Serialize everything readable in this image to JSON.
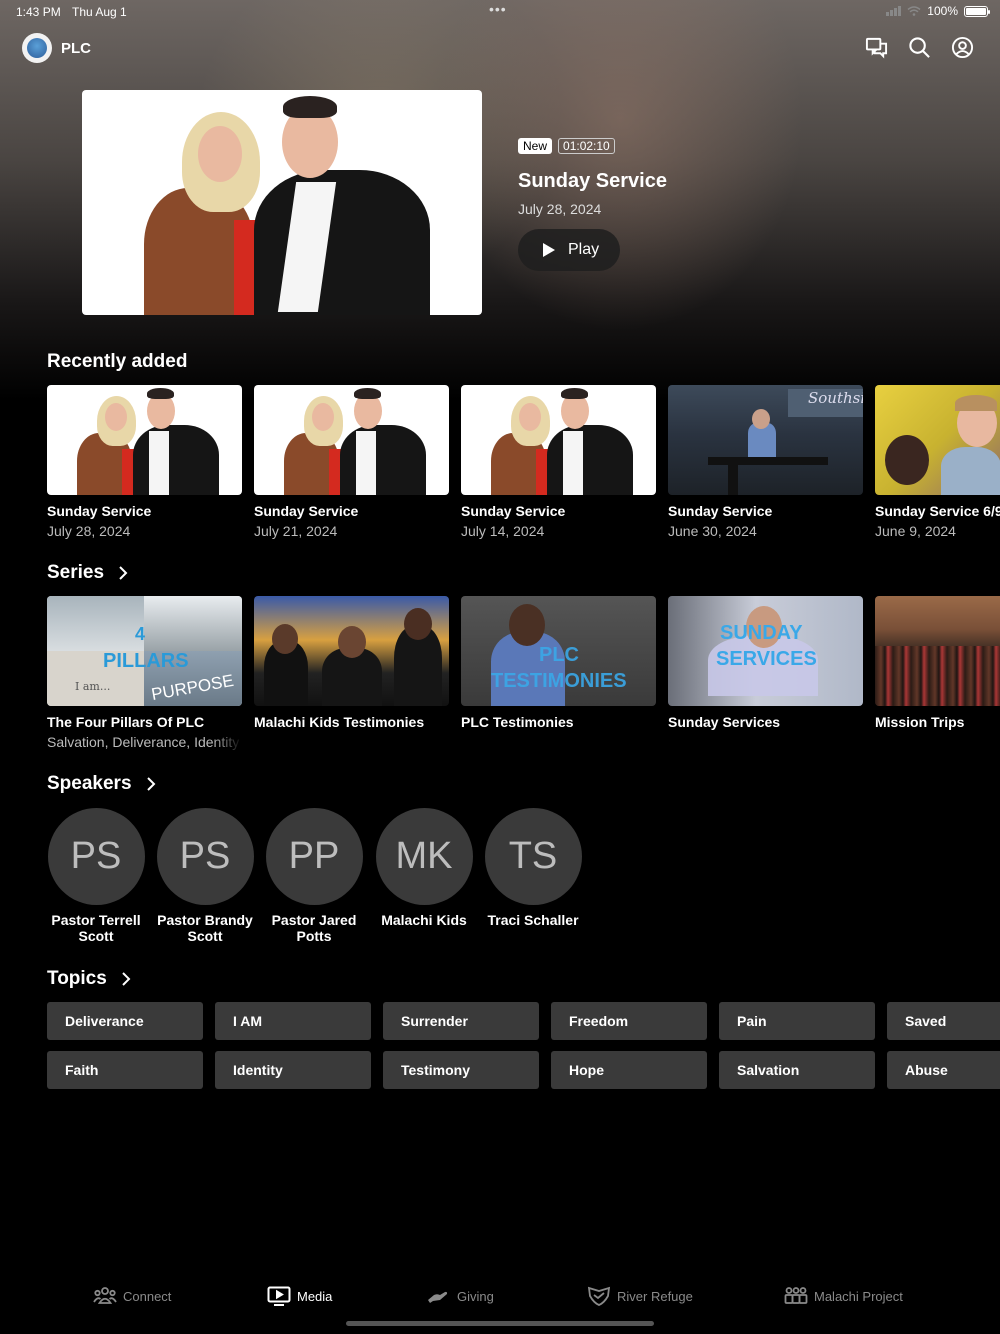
{
  "status_bar": {
    "time": "1:43 PM",
    "date": "Thu Aug 1",
    "battery": "100%",
    "battery_level": 1.0
  },
  "header": {
    "app_name": "PLC",
    "icons": [
      "chat-icon",
      "search-icon",
      "account-icon"
    ]
  },
  "hero": {
    "badge_new": "New",
    "duration": "01:02:10",
    "title": "Sunday Service",
    "date": "July 28, 2024",
    "play_label": "Play"
  },
  "recently_added": {
    "title": "Recently added",
    "items": [
      {
        "title": "Sunday Service",
        "date": "July 28, 2024"
      },
      {
        "title": "Sunday Service",
        "date": "July 21, 2024"
      },
      {
        "title": "Sunday Service",
        "date": "July 14, 2024"
      },
      {
        "title": "Sunday Service",
        "date": "June 30, 2024"
      },
      {
        "title": "Sunday Service 6/9",
        "date": "June 9, 2024"
      }
    ]
  },
  "series": {
    "title": "Series",
    "items": [
      {
        "title": "The Four Pillars Of PLC",
        "subtitle": "Salvation, Deliverance, Identity",
        "thumb_text": [
          "4",
          "PILLARS",
          "I am...",
          "PURPOSE"
        ]
      },
      {
        "title": "Malachi Kids Testimonies",
        "subtitle": ""
      },
      {
        "title": "PLC Testimonies",
        "subtitle": "",
        "thumb_text": [
          "PLC",
          "TESTIMONIES"
        ]
      },
      {
        "title": "Sunday Services",
        "subtitle": "",
        "thumb_text": [
          "SUNDAY",
          "SERVICES"
        ]
      },
      {
        "title": "Mission Trips",
        "subtitle": ""
      }
    ]
  },
  "speakers": {
    "title": "Speakers",
    "items": [
      {
        "initials": "PS",
        "name": "Pastor Terrell Scott"
      },
      {
        "initials": "PS",
        "name": "Pastor Brandy Scott"
      },
      {
        "initials": "PP",
        "name": "Pastor Jared Potts"
      },
      {
        "initials": "MK",
        "name": "Malachi Kids"
      },
      {
        "initials": "TS",
        "name": "Traci Schaller"
      }
    ]
  },
  "topics": {
    "title": "Topics",
    "items": [
      "Deliverance",
      "I AM",
      "Surrender",
      "Freedom",
      "Pain",
      "Saved",
      "Faith",
      "Identity",
      "Testimony",
      "Hope",
      "Salvation",
      "Abuse"
    ]
  },
  "tabbar": {
    "items": [
      {
        "label": "Connect",
        "icon": "people-icon"
      },
      {
        "label": "Media",
        "icon": "tv-icon",
        "active": true
      },
      {
        "label": "Giving",
        "icon": "hand-icon"
      },
      {
        "label": "River Refuge",
        "icon": "handshake-shield-icon"
      },
      {
        "label": "Malachi Project",
        "icon": "group-icon"
      }
    ]
  },
  "colors": {
    "background": "#000000",
    "tile": "#3a3a3a",
    "inactive_tab": "#8a8a8a",
    "text": "#ffffff"
  }
}
